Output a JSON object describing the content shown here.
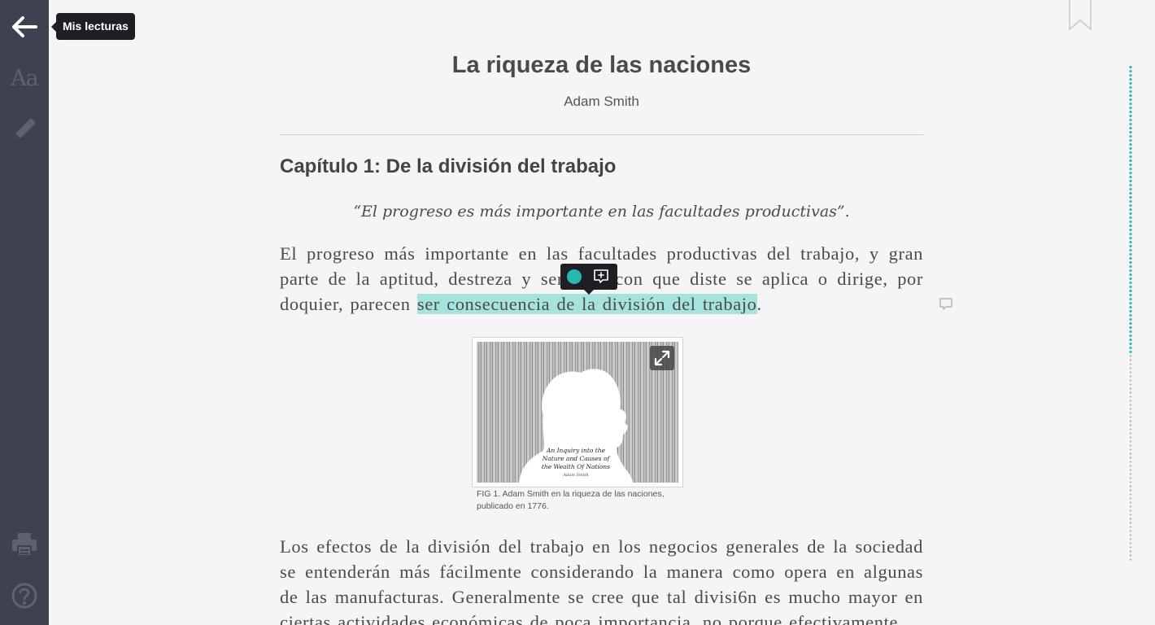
{
  "sidebar": {
    "back_tooltip": "Mis lecturas",
    "font_settings_glyph": "Aa",
    "icons": [
      "arrow-left-icon",
      "font-size-icon",
      "pencil-icon",
      "printer-icon",
      "help-circle-icon"
    ]
  },
  "book": {
    "title": "La riqueza de las naciones",
    "author": "Adam Smith"
  },
  "chapter": {
    "title": "Capítulo 1: De la división del trabajo",
    "epigraph": "“El progreso es más importante en las facultades productivas”.",
    "paragraph1": {
      "before": "El progreso más importante en las facultades productivas del trabajo, y gran parte de la aptitud, destreza y sensatez con que diste se aplica o dirige, por doquier, parecen ",
      "highlighted": "ser consecuencia de la división del trabajo",
      "after": "."
    },
    "paragraph2": "Los efectos de la división del trabajo en los negocios generales de la sociedad se entenderán más fácilmente considerando la manera como opera en algunas de las manufacturas. Generalmente se cree que tal divisi6n es mucho mayor en ciertas actividades económicas de poca importancia, no porque efectivamente"
  },
  "figure": {
    "caption": "FIG 1. Adam Smith en la riqueza de las naciones, publicado en 1776.",
    "image_text": [
      "An Inquiry into the",
      "Nature and Causes of",
      "the Wealth Of Nations",
      "Adam Smith"
    ]
  },
  "highlight": {
    "color": "#26b8ad",
    "fill": "#a6e3dd"
  },
  "reading_progress": 0.58
}
